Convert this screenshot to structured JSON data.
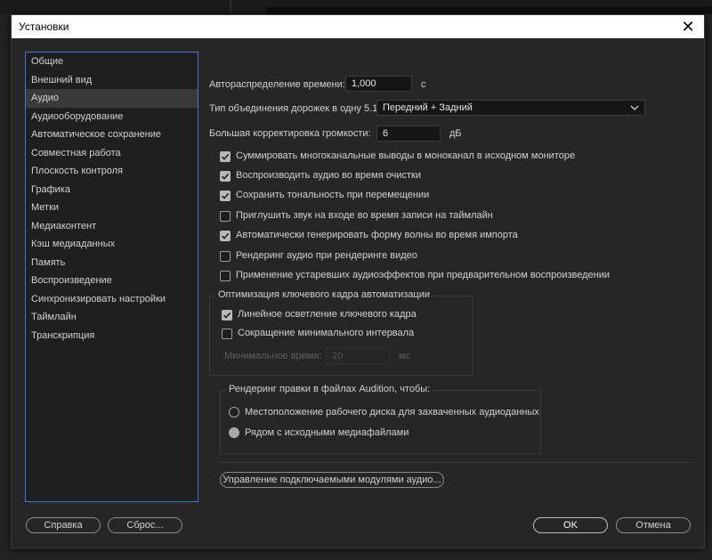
{
  "window": {
    "title": "Установки",
    "close_glyph": "✕"
  },
  "sidebar": {
    "items": [
      {
        "label": "Общие",
        "selected": false
      },
      {
        "label": "Внешний вид",
        "selected": false
      },
      {
        "label": "Аудио",
        "selected": true
      },
      {
        "label": "Аудиооборудование",
        "selected": false
      },
      {
        "label": "Автоматическое сохранение",
        "selected": false
      },
      {
        "label": "Совместная работа",
        "selected": false
      },
      {
        "label": "Плоскость контроля",
        "selected": false
      },
      {
        "label": "Графика",
        "selected": false
      },
      {
        "label": "Метки",
        "selected": false
      },
      {
        "label": "Медиаконтент",
        "selected": false
      },
      {
        "label": "Кэш медиаданных",
        "selected": false
      },
      {
        "label": "Память",
        "selected": false
      },
      {
        "label": "Воспроизведение",
        "selected": false
      },
      {
        "label": "Синхронизировать настройки",
        "selected": false
      },
      {
        "label": "Таймлайн",
        "selected": false
      },
      {
        "label": "Транскрипция",
        "selected": false
      }
    ]
  },
  "audio": {
    "auto_distribution": {
      "label": "Автораспределение времени:",
      "value": "1,000",
      "unit": "с"
    },
    "downmix": {
      "label": "Тип объединения дорожек в одну 5.1:",
      "value": "Передний + Задний"
    },
    "loudness": {
      "label": "Большая корректировка громкости:",
      "value": "6",
      "unit": "дБ"
    },
    "checkboxes": [
      {
        "label": "Суммировать многоканальные выводы в моноканал в исходном мониторе",
        "checked": true
      },
      {
        "label": "Воспроизводить аудио во время очистки",
        "checked": true
      },
      {
        "label": "Сохранить тональность при перемещении",
        "checked": true
      },
      {
        "label": "Приглушить звук на входе во время записи на таймлайн",
        "checked": false
      },
      {
        "label": "Автоматически генерировать форму волны во время импорта",
        "checked": true
      },
      {
        "label": "Рендеринг аудио при рендеринге видео",
        "checked": false
      },
      {
        "label": "Применение устаревших аудиоэффектов при предварительном воспроизведении",
        "checked": false
      }
    ],
    "keyframe_group": {
      "title": "Оптимизация ключевого кадра автоматизации",
      "linear": {
        "label": "Линейное осветление ключевого кадра",
        "checked": true
      },
      "min_interval": {
        "label": "Сокращение минимального интервала",
        "checked": false
      },
      "min_time": {
        "label": "Минимальное время:",
        "value": "20",
        "unit": "мс"
      }
    },
    "audition_group": {
      "title": "Рендеринг правки в файлах Audition, чтобы:",
      "options": [
        {
          "label": "Местоположение рабочего диска для захваченных аудиоданных",
          "checked": false
        },
        {
          "label": "Рядом с исходными медиафайлами",
          "checked": true
        }
      ]
    },
    "plugins_button": "Управление подключаемыми модулями аудио..."
  },
  "footer": {
    "help": "Справка",
    "reset": "Сброс...",
    "ok": "OK",
    "cancel": "Отмена"
  },
  "colors": {
    "accent_border": "#3d7ccd",
    "background": "#262626",
    "selected_item": "#3a3a3a"
  }
}
